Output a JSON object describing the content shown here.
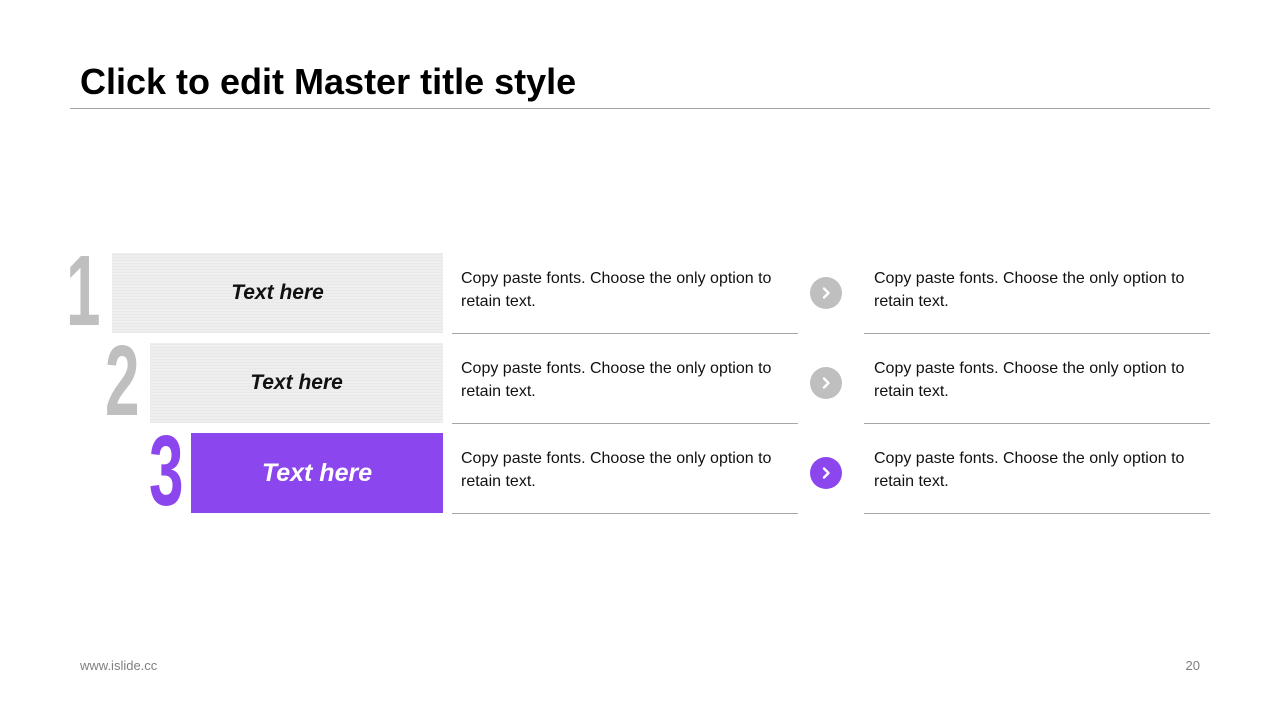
{
  "slide": {
    "title": "Click to edit Master title style",
    "footer_url": "www.islide.cc",
    "page_number": "20"
  },
  "colors": {
    "accent": "#8b46ee",
    "gray_number": "#bfbfbf",
    "gray_box": "#eeeeee",
    "rule": "#a6a6a6"
  },
  "steps": [
    {
      "number": "1",
      "label": "Text here",
      "left_text": "Copy paste fonts. Choose the only option to retain text.",
      "right_text": "Copy paste fonts. Choose the only option to retain text.",
      "icon": "chevron-right-icon"
    },
    {
      "number": "2",
      "label": "Text here",
      "left_text": "Copy paste fonts. Choose the only option to retain text.",
      "right_text": "Copy paste fonts. Choose the only option to retain text.",
      "icon": "chevron-right-icon"
    },
    {
      "number": "3",
      "label": "Text here",
      "left_text": "Copy paste fonts. Choose the only option to retain text.",
      "right_text": "Copy paste fonts. Choose the only option to retain text.",
      "icon": "chevron-right-icon"
    }
  ]
}
